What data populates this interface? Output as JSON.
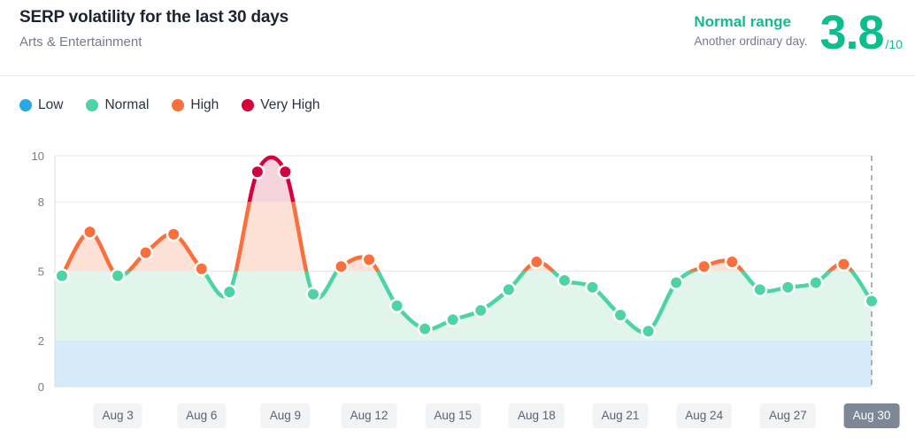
{
  "header": {
    "title": "SERP volatility for the last 30 days",
    "subtitle": "Arts & Entertainment",
    "range_label": "Normal range",
    "range_note": "Another ordinary day.",
    "score_value": "3.8",
    "score_max": "/10"
  },
  "legend": {
    "items": [
      {
        "label": "Low",
        "color": "#27aae1"
      },
      {
        "label": "Normal",
        "color": "#4ed4a4"
      },
      {
        "label": "High",
        "color": "#fb6f3c"
      },
      {
        "label": "Very High",
        "color": "#d6003c"
      }
    ]
  },
  "colors": {
    "low_band": "#d6ebfa",
    "normal_band": "#e2f5ec",
    "high_band": "#fde1d6",
    "very_high_band": "#f7d3de",
    "line_normal": "#4ed4a4",
    "line_high": "#fb6f3c",
    "line_very_high": "#d6003c",
    "gridline": "#e8e6ef",
    "axis": "#d8dce1",
    "today_marker": "#9aa0aa"
  },
  "chart_data": {
    "type": "line",
    "title": "SERP volatility for the last 30 days",
    "subtitle": "Arts & Entertainment",
    "xlabel": "",
    "ylabel": "",
    "ylim": [
      0,
      10
    ],
    "yticks": [
      0,
      2,
      5,
      8,
      10
    ],
    "grid": true,
    "legend_position": "top-left",
    "bands": [
      {
        "name": "Low",
        "from": 0,
        "to": 2,
        "color": "#d6ebfa"
      },
      {
        "name": "Normal",
        "from": 2,
        "to": 5,
        "color": "#e2f5ec"
      },
      {
        "name": "High",
        "from": 5,
        "to": 8,
        "color": "#fde1d6"
      },
      {
        "name": "Very High",
        "from": 8,
        "to": 10,
        "color": "#f7d3de"
      }
    ],
    "xtick_labels": [
      "Aug 3",
      "Aug 6",
      "Aug 9",
      "Aug 12",
      "Aug 15",
      "Aug 18",
      "Aug 21",
      "Aug 24",
      "Aug 27",
      "Aug 30"
    ],
    "xtick_indices": [
      2,
      5,
      8,
      11,
      14,
      17,
      20,
      23,
      26,
      29
    ],
    "current_index": 29,
    "x": [
      "Aug 1",
      "Aug 2",
      "Aug 3",
      "Aug 4",
      "Aug 5",
      "Aug 6",
      "Aug 7",
      "Aug 8",
      "Aug 9",
      "Aug 10",
      "Aug 11",
      "Aug 12",
      "Aug 13",
      "Aug 14",
      "Aug 15",
      "Aug 16",
      "Aug 17",
      "Aug 18",
      "Aug 19",
      "Aug 20",
      "Aug 21",
      "Aug 22",
      "Aug 23",
      "Aug 24",
      "Aug 25",
      "Aug 26",
      "Aug 27",
      "Aug 28",
      "Aug 29",
      "Aug 30"
    ],
    "values": [
      4.8,
      6.7,
      4.8,
      5.8,
      6.6,
      5.1,
      4.1,
      9.3,
      9.3,
      4.0,
      5.2,
      5.5,
      3.5,
      2.5,
      2.9,
      3.3,
      4.2,
      5.4,
      4.6,
      4.3,
      3.1,
      2.4,
      4.5,
      5.2,
      5.4,
      4.2,
      4.3,
      4.5,
      5.3,
      3.7
    ],
    "last_value": 3.8,
    "point_levels": [
      "normal",
      "high",
      "normal",
      "high",
      "high",
      "high",
      "normal",
      "very_high",
      "very_high",
      "normal",
      "high",
      "high",
      "normal",
      "normal",
      "normal",
      "normal",
      "normal",
      "high",
      "normal",
      "normal",
      "normal",
      "normal",
      "normal",
      "high",
      "high",
      "normal",
      "normal",
      "normal",
      "high",
      "normal"
    ]
  }
}
